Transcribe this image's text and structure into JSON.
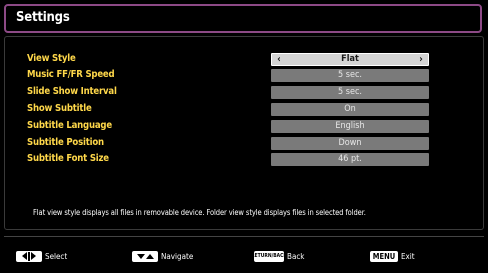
{
  "header": {
    "title": "Settings"
  },
  "settings": [
    {
      "label": "View Style",
      "value": "Flat",
      "selected": true
    },
    {
      "label": "Music FF/FR Speed",
      "value": "5 sec.",
      "selected": false
    },
    {
      "label": "Slide Show Interval",
      "value": "5 sec.",
      "selected": false
    },
    {
      "label": "Show Subtitle",
      "value": "On",
      "selected": false
    },
    {
      "label": "Subtitle Language",
      "value": "English",
      "selected": false
    },
    {
      "label": "Subtitle Position",
      "value": "Down",
      "selected": false
    },
    {
      "label": "Subtitle Font Size",
      "value": "46 pt.",
      "selected": false
    }
  ],
  "info": {
    "text": "Flat view style displays all files in removable device. Folder view style displays files in selected folder."
  },
  "footer": {
    "select_label": "Select",
    "navigate_label": "Navigate",
    "back_key": "RETURN/BACK",
    "back_label": "Back",
    "menu_key": "MENU",
    "exit_label": "Exit"
  },
  "colors": {
    "label_yellow": "#ffd84a",
    "title_border": "#8d4a86",
    "value_box": "#7a7a7a",
    "value_box_selected": "#d4d4d4"
  },
  "icons": {
    "select_key": "left-right-arrows-icon",
    "navigate_key": "down-up-arrows-icon"
  }
}
